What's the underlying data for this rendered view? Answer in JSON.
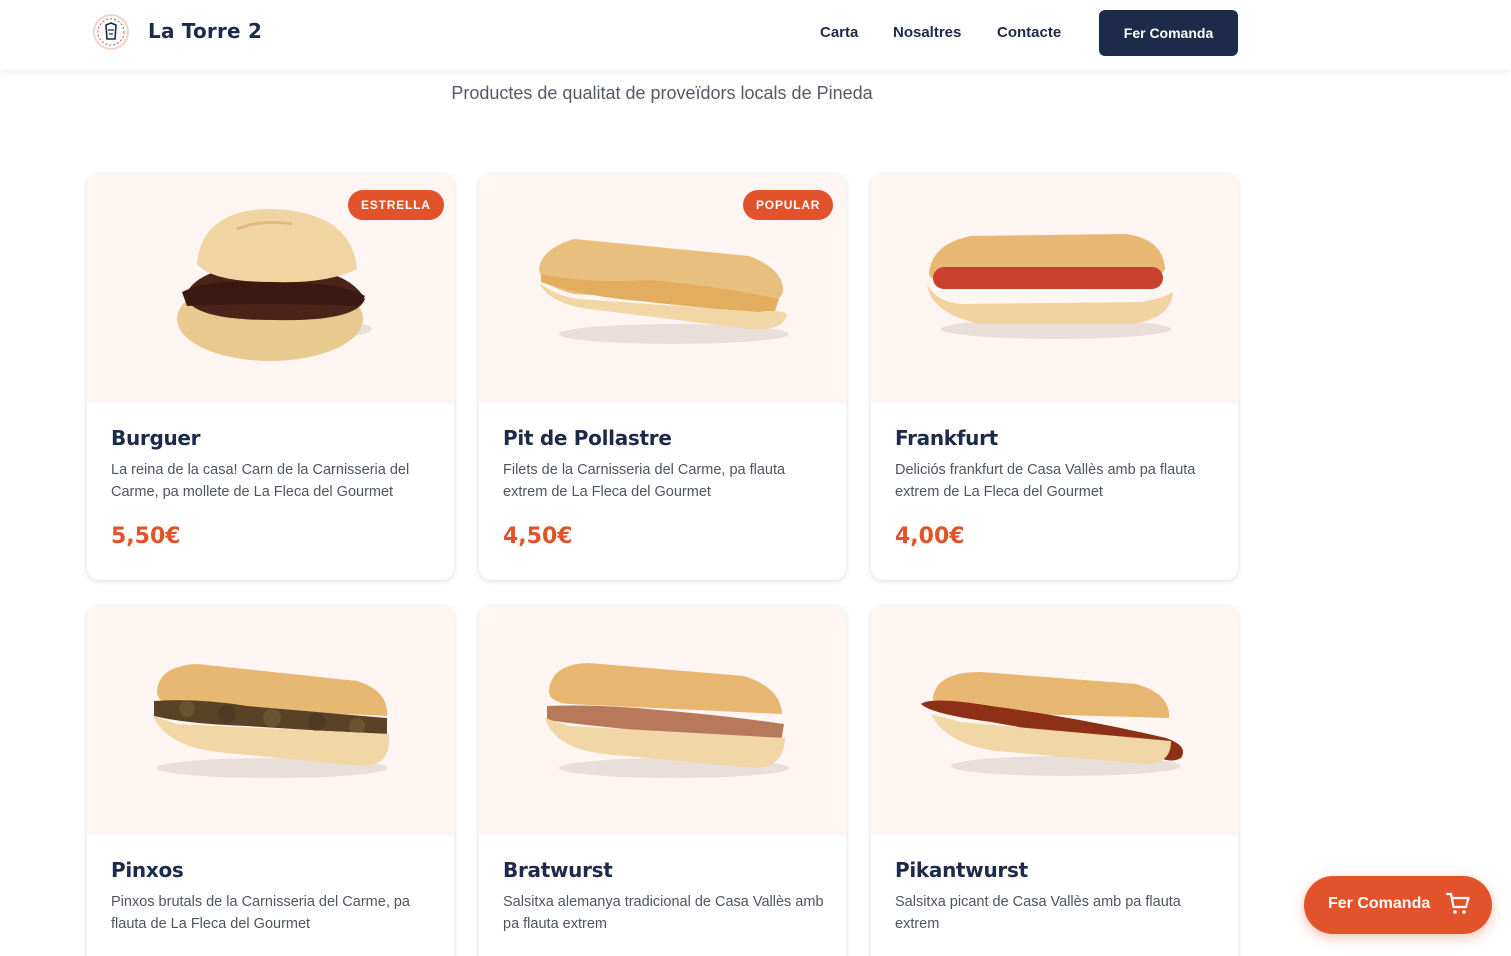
{
  "header": {
    "brand": "La Torre 2",
    "nav": [
      {
        "label": "Carta"
      },
      {
        "label": "Nosaltres"
      },
      {
        "label": "Contacte"
      }
    ],
    "cta_label": "Fer Comanda"
  },
  "subtitle": "Productes de qualitat de proveïdors locals de Pineda",
  "products": [
    {
      "name": "Burguer",
      "badge": "ESTRELLA",
      "description": "La reina de la casa! Carn de la Carnisseria del Carme, pa mollete de La Fleca del Gourmet",
      "price": "5,50€"
    },
    {
      "name": "Pit de Pollastre",
      "badge": "POPULAR",
      "description": "Filets de la Carnisseria del Carme, pa flauta extrem de La Fleca del Gourmet",
      "price": "4,50€"
    },
    {
      "name": "Frankfurt",
      "badge": "",
      "description": "Deliciós frankfurt de Casa Vallès amb pa flauta extrem de La Fleca del Gourmet",
      "price": "4,00€"
    },
    {
      "name": "Pinxos",
      "badge": "",
      "description": "Pinxos brutals de la Carnisseria del Carme, pa flauta de La Fleca del Gourmet",
      "price": ""
    },
    {
      "name": "Bratwurst",
      "badge": "",
      "description": "Salsitxa alemanya tradicional de Casa Vallès amb pa flauta extrem",
      "price": ""
    },
    {
      "name": "Pikantwurst",
      "badge": "",
      "description": "Salsitxa picant de Casa Vallès amb pa flauta extrem",
      "price": ""
    }
  ],
  "floating_cta": {
    "label": "Fer Comanda",
    "icon": "cart-icon"
  },
  "colors": {
    "navy": "#1d2b4a",
    "accent": "#e2522b",
    "image_bg": "#fff5f3"
  }
}
